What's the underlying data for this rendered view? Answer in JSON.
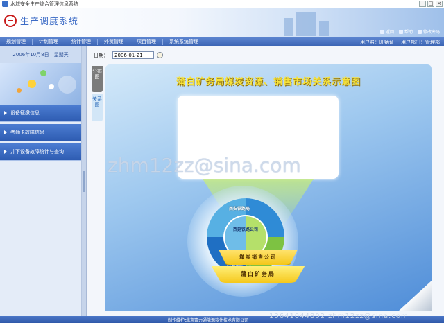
{
  "window": {
    "title": "水城安全生产综合管理信息系统"
  },
  "header": {
    "app_name": "生产调度系统",
    "links": [
      {
        "label": "返回"
      },
      {
        "label": "帮助"
      },
      {
        "label": "修改密码"
      }
    ]
  },
  "menu": {
    "items": [
      "规划管理",
      "计划管理",
      "统计管理",
      "外贸管理",
      "项目管理",
      "系统系统管理"
    ],
    "user_label": "用户名：旺钠证",
    "dept_label": "用户部门：管理部"
  },
  "sidebar": {
    "date_text": "2006年10月8日　星期天",
    "items": [
      {
        "label": "设备征缴信息"
      },
      {
        "label": "考勤卡故障信息"
      },
      {
        "label": "井下设备故障统计与查询"
      }
    ]
  },
  "content": {
    "date_label": "日期：",
    "date_value": "2006-01-21",
    "tabs": [
      {
        "label": "分布图"
      },
      {
        "label": "关系图"
      }
    ],
    "diagram_title": "蒲白矿务局煤炭资源、销售市场关系示意图",
    "center_node": "西延铁路公司",
    "ring_nodes": [
      "西安铁路局",
      "铁路运输公司"
    ],
    "arcs": [
      "煤炭销售公司",
      "蒲白矿务局"
    ]
  },
  "watermark": {
    "text": "zhm12zz@sina.com",
    "footer_text": "13641044802  zhm12zz@sina.com"
  },
  "footer": {
    "label": "制作维护：",
    "company": "北京富力通能源软件技术有限公司"
  }
}
